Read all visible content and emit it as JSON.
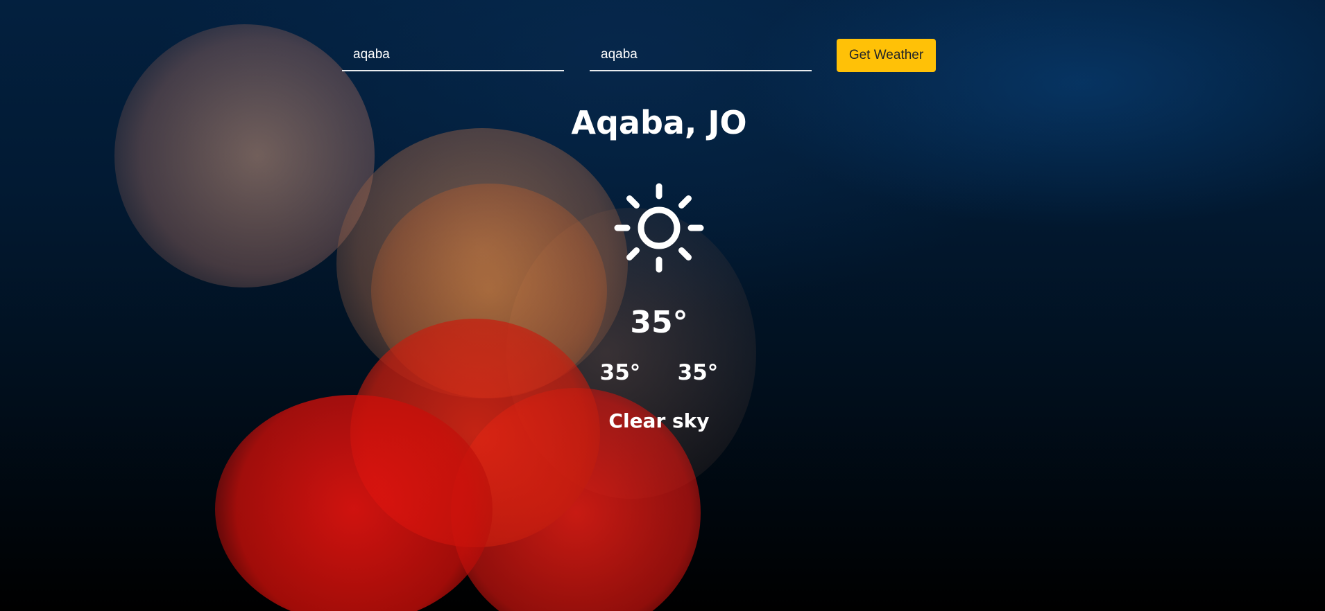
{
  "search": {
    "city_value": "aqaba",
    "country_value": "aqaba",
    "button_label": "Get Weather"
  },
  "weather": {
    "location": "Aqaba, JO",
    "icon": "sun-icon",
    "temperature": "35°",
    "temp_min": "35°",
    "temp_max": "35°",
    "description": "Clear sky"
  },
  "colors": {
    "button_background": "#ffc107",
    "button_text": "#212529",
    "text": "#ffffff"
  }
}
